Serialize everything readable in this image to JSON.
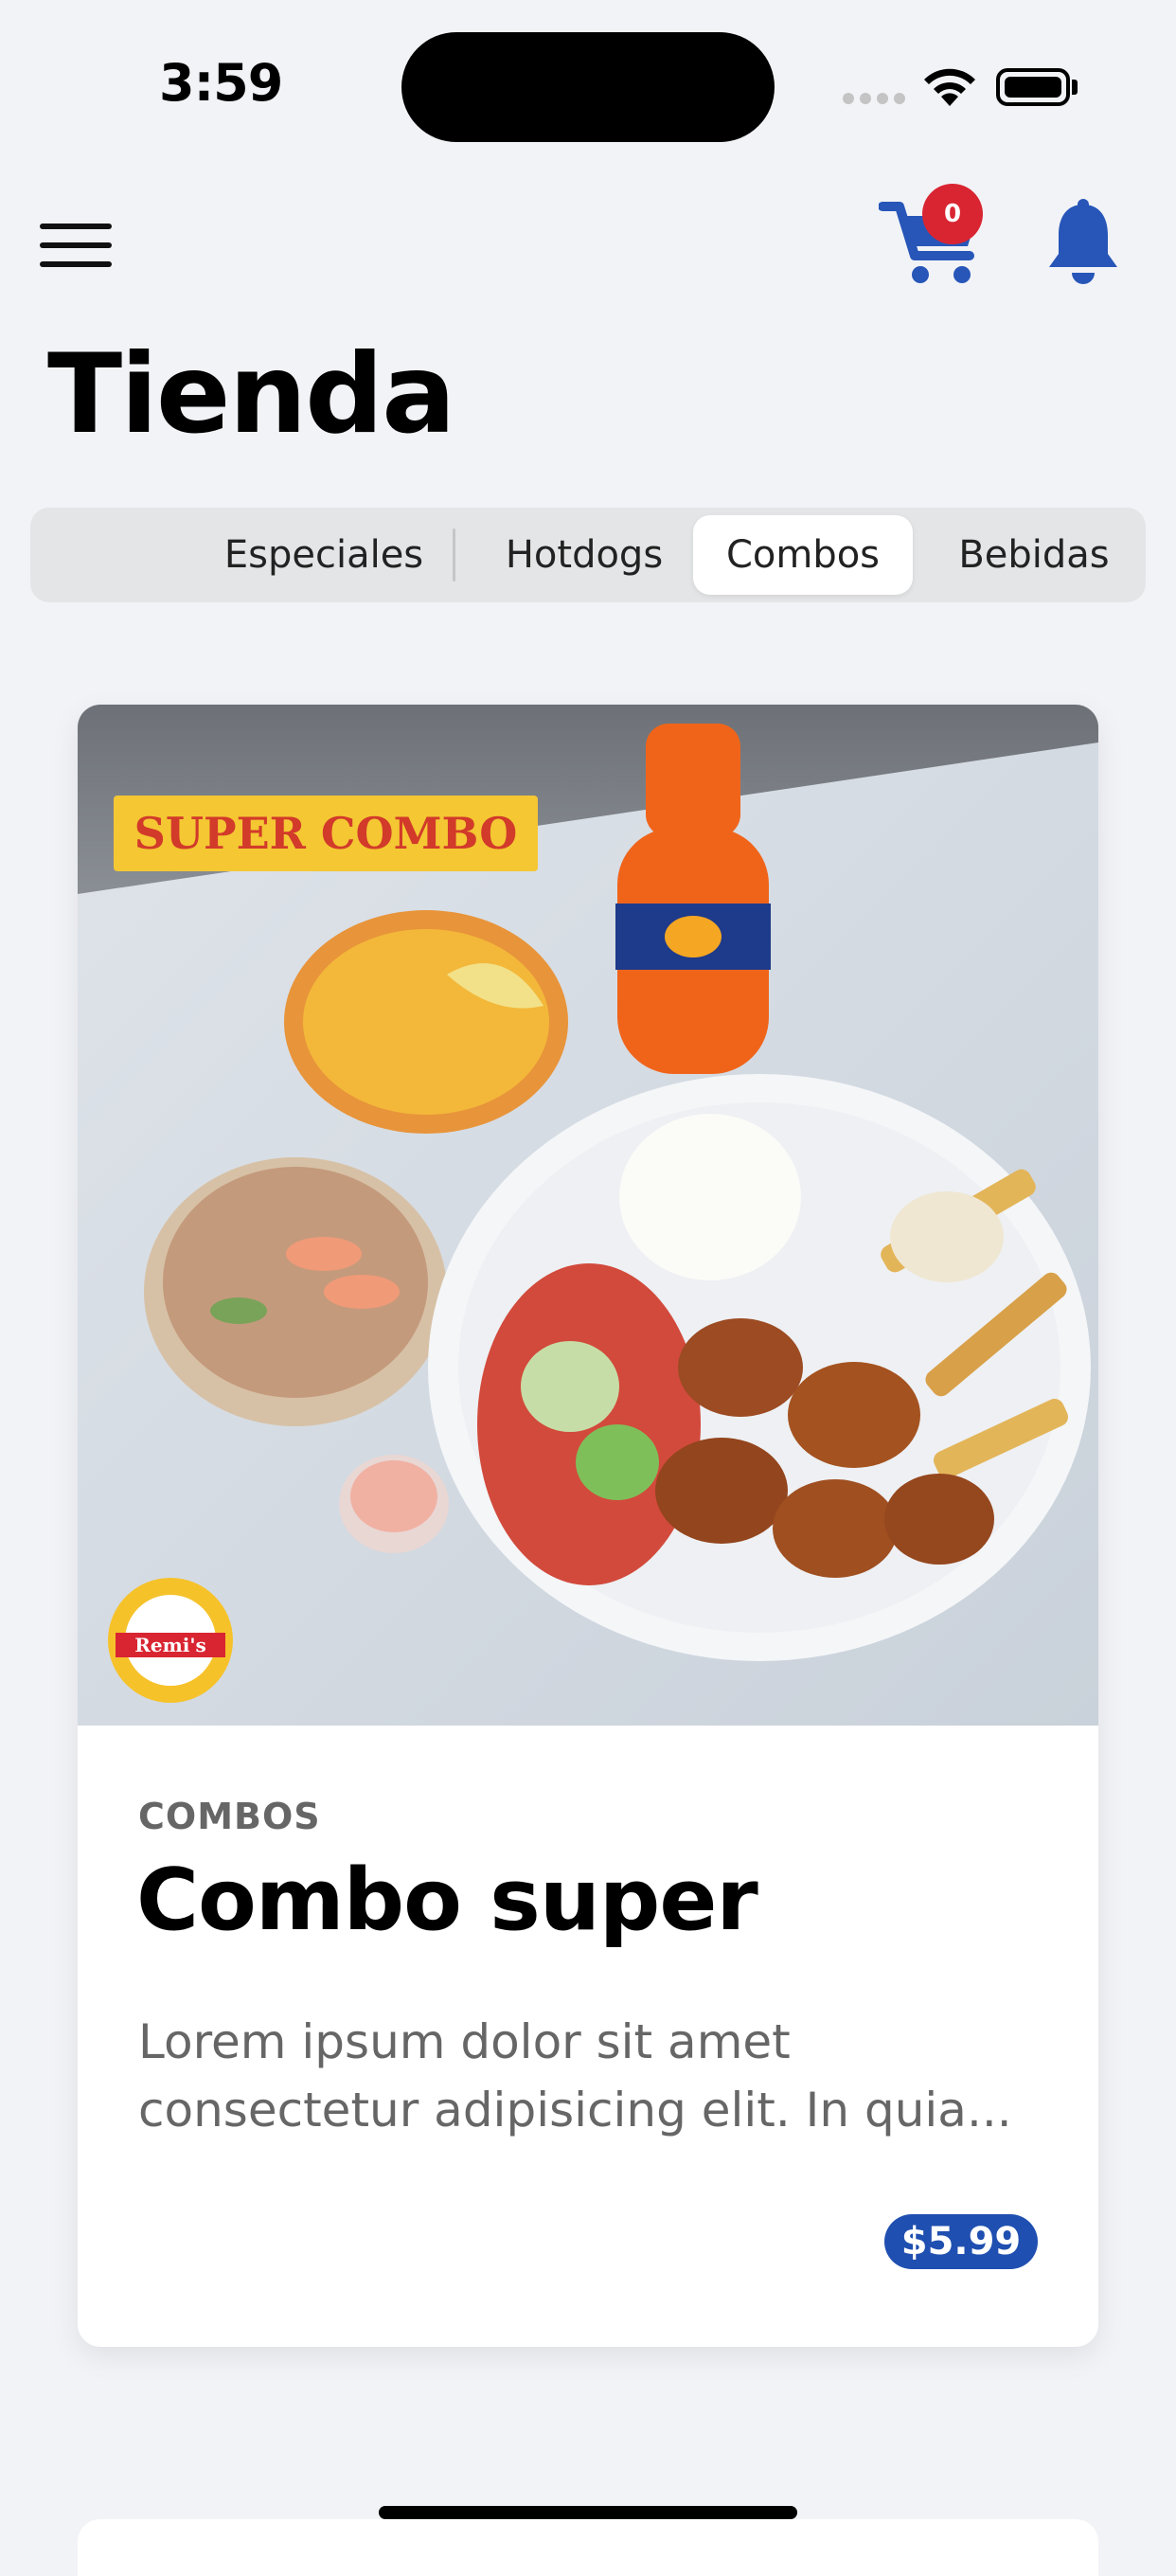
{
  "status": {
    "time": "3:59"
  },
  "header": {
    "cart_count": "0"
  },
  "page": {
    "title": "Tienda"
  },
  "tabs": [
    {
      "label": "Especiales"
    },
    {
      "label": "Hotdogs"
    },
    {
      "label": "Combos",
      "active": true
    },
    {
      "label": "Bebidas"
    }
  ],
  "card": {
    "image_banner": "SUPER COMBO",
    "logo_text": "Remi's",
    "category": "COMBOS",
    "title": "Combo super",
    "description_line1": "Lorem ipsum dolor sit amet",
    "description_line2": "consectetur adipisicing elit. In quia...",
    "price": "$5.99"
  },
  "colors": {
    "accent": "#2756b8",
    "badge_red": "#d92532",
    "price_bg": "#1f4fb0",
    "background": "#f2f3f7"
  },
  "icons": [
    "menu-icon",
    "cart-icon",
    "bell-icon",
    "wifi-icon",
    "battery-icon"
  ]
}
